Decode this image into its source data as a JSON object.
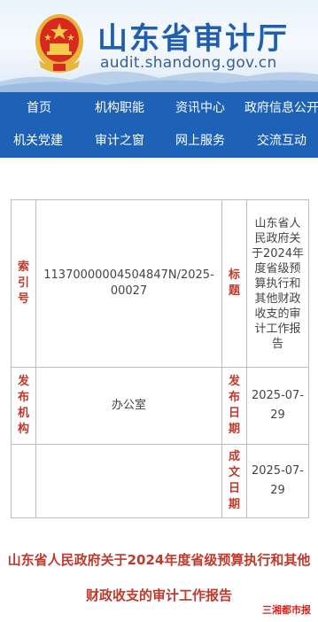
{
  "header": {
    "site_title": "山东省审计厅",
    "site_domain": "audit.shandong.gov.cn"
  },
  "nav": {
    "row1": [
      "首页",
      "机构职能",
      "资讯中心",
      "政府信息公开"
    ],
    "row2": [
      "机关党建",
      "审计之窗",
      "网上服务",
      "交流互动"
    ]
  },
  "info": {
    "index_label": "索引号",
    "index_value": "11370000004504847N/2025-00027",
    "title_label": "标题",
    "title_value": "山东省人民政府关于2024年度省级预算执行和其他财政收支的审计工作报告",
    "publisher_label": "发布机构",
    "publisher_value": "办公室",
    "publish_date_label": "发布日期",
    "publish_date_value": "2025-07-29",
    "create_date_label": "成文日期",
    "create_date_value": "2025-07-29"
  },
  "document": {
    "heading": "山东省人民政府关于2024年度省级预算执行和其他财政收支的审计工作报告"
  },
  "watermark": "三湘都市报",
  "colors": {
    "nav_bg": "#1e62b8",
    "brand_blue": "#1f5fae",
    "label_red": "#c0392b"
  }
}
